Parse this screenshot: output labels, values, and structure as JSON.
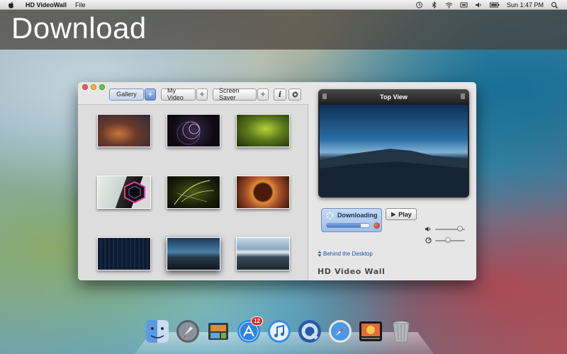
{
  "menubar": {
    "app_name": "HD VideoWall",
    "menu_file": "File",
    "clock": "Sun 1:47 PM"
  },
  "banner": {
    "title": "Download"
  },
  "window": {
    "toolbar": {
      "gallery": "Gallery",
      "my_video": "My Video",
      "screen_saver": "Screen Saver",
      "info": "i"
    },
    "gallery_thumbnails": [
      "thumb-1",
      "thumb-2",
      "thumb-3",
      "thumb-4",
      "thumb-5",
      "thumb-6",
      "thumb-7",
      "thumb-8",
      "thumb-9"
    ],
    "preview": {
      "title": "Top View"
    },
    "download": {
      "label": "Downloading",
      "progress": 0.8
    },
    "play_label": "Play",
    "volume_level": 0.9,
    "speed_level": 0.4,
    "behind_desktop": "Behind the Desktop",
    "brand": "HD Video Wall"
  },
  "dock": {
    "apps": [
      "finder-icon",
      "launchpad-icon",
      "preview-icon",
      "app-store-icon",
      "itunes-icon",
      "quicktime-icon",
      "safari-icon",
      "hd-videowall-icon",
      "trash-icon"
    ],
    "app_store_badge": "12"
  },
  "colors": {
    "banner": "#463e38",
    "accent": "#5f8fd2",
    "stop": "#b2241a"
  }
}
